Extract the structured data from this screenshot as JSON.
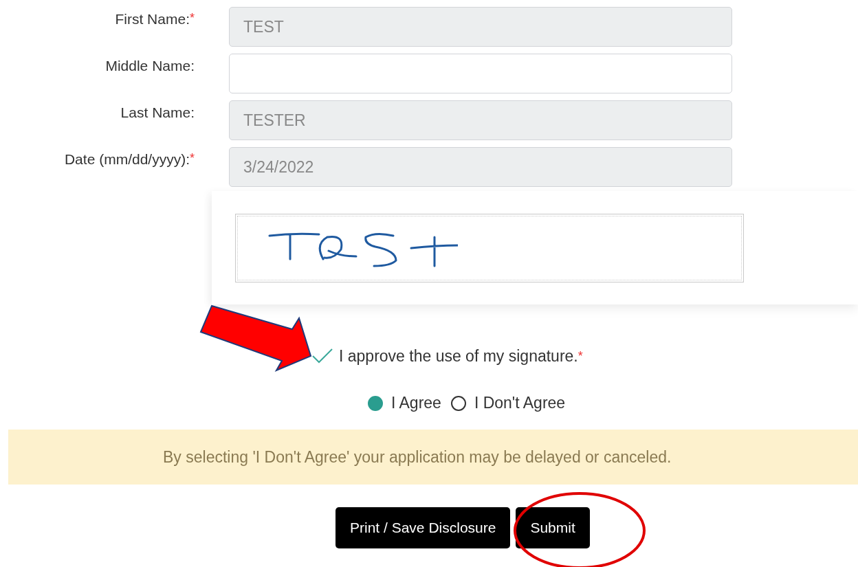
{
  "fields": [
    {
      "label": "First Name:",
      "required_mark": "*",
      "value": "TEST",
      "disabled": true
    },
    {
      "label": "Middle Name:",
      "disabled": false
    },
    {
      "label": "Last Name:",
      "value": "TESTER",
      "disabled": true
    },
    {
      "label": "Date (mm/dd/yyyy):",
      "required_mark": "*",
      "value": "3/24/2022",
      "disabled": true
    }
  ],
  "approval": {
    "label": "I approve the use of my signature.",
    "required_mark": "*",
    "checked": true
  },
  "options": [
    {
      "label": "I Agree",
      "selected": true
    },
    {
      "label": "I Don't Agree",
      "selected": false
    }
  ],
  "notice": "By selecting 'I Don't Agree' your application may be delayed or canceled.",
  "buttons": [
    "Print / Save Disclosure",
    "Submit"
  ]
}
